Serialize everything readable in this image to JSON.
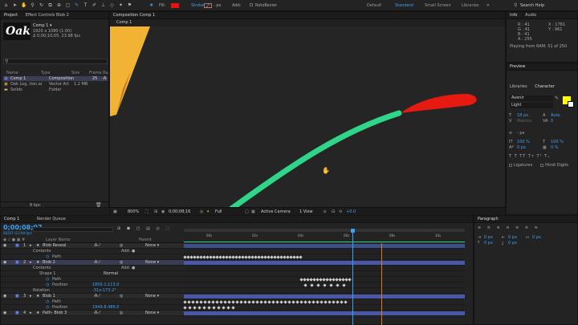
{
  "toolbar": {
    "fill_label": "Fill:",
    "stroke_label": "Stroke:",
    "stroke_width": "- px",
    "add_label": "Add:",
    "rotobezier_label": "RotoBezier",
    "workspaces": [
      "Default",
      "Standard",
      "Small Screen",
      "Libraries"
    ],
    "search_placeholder": "Search Help"
  },
  "project": {
    "tab_project": "Project",
    "tab_effect_controls": "Effect Controls Blob 2",
    "comp_name": "Comp 1 ▾",
    "comp_info1": "1920 x 1080 (1.00)",
    "comp_info2": "Δ 0;00;10;05, 23.98 fps",
    "logo_text": "Oak",
    "columns": [
      "Name",
      "Type",
      "Size",
      "Frame Ra..."
    ],
    "items": [
      {
        "name": "Comp 1",
        "type": "Composition",
        "size": "",
        "rate": "25"
      },
      {
        "name": "Oak Log..tion.ai",
        "type": "Vector Art",
        "size": "1.2 MB",
        "rate": ""
      },
      {
        "name": "Solids",
        "type": "Folder",
        "size": "",
        "rate": ""
      }
    ],
    "bpc": "8 bpc"
  },
  "composition": {
    "tab": "Composition Comp 1",
    "comp_tab": "Comp 1",
    "zoom": "800%",
    "timecode": "0;00;08;16",
    "resolution": "Full",
    "camera": "Active Camera",
    "views": "1 View",
    "exposure": "+0.0"
  },
  "info": {
    "tab_info": "Info",
    "tab_audio": "Audio",
    "r": "R : 41",
    "g": "G : 41",
    "b": "B : 41",
    "a": "A : 255",
    "x": "X : 1781",
    "y": "Y : 961",
    "playing": "Playing from RAM: 51 of 250",
    "preview": "Preview",
    "libraries": "Libraries",
    "character": "Character"
  },
  "character": {
    "font": "Avenir",
    "style": "Light",
    "size": "18 px",
    "leading": "Auto",
    "kerning": "Metrics",
    "tracking": "0",
    "stroke": "- px",
    "vscale": "100 %",
    "hscale": "100 %",
    "baseline": "0 px",
    "tsume": "0 %",
    "ligatures": "Ligatures",
    "hindi": "Hindi Digits",
    "fill_color": "#ffff00",
    "stroke_color": "#ffffff"
  },
  "paragraph": {
    "tab": "Paragraph",
    "v1": "0 px",
    "v2": "0 px",
    "v3": "0 px",
    "v4": "0 px",
    "v5": "0 px"
  },
  "timeline": {
    "tab_comp": "Comp 1",
    "tab_render": "Render Queue",
    "timecode": "0;00;08;07",
    "fps_line": "00207 (23.98 fps)",
    "col_layer": "Layer Name",
    "col_parent": "Parent",
    "ruler": [
      "00s",
      "02s",
      "04s",
      "06s",
      "08s",
      "10s",
      "12s"
    ],
    "rows": [
      {
        "kind": "layer",
        "num": "1",
        "name": "Blob Reveal",
        "parent": "None",
        "sel": false
      },
      {
        "kind": "prop",
        "name": "Contents",
        "add": "Add: ●"
      },
      {
        "kind": "sub",
        "name": "Path"
      },
      {
        "kind": "layer",
        "num": "2",
        "name": "Blob 2",
        "parent": "None",
        "sel": true
      },
      {
        "kind": "prop",
        "name": "Contents",
        "add": "Add: ●"
      },
      {
        "kind": "prop2",
        "name": "Shape 1",
        "value": "Normal"
      },
      {
        "kind": "sub",
        "name": "Path"
      },
      {
        "kind": "sub",
        "name": "Position",
        "value": "1809.1,113.0"
      },
      {
        "kind": "prop",
        "name": "Rotation",
        "value": "-31x-173.2°"
      },
      {
        "kind": "layer",
        "num": "3",
        "name": "Blob 1",
        "parent": "None",
        "sel": false
      },
      {
        "kind": "sub",
        "name": "Path"
      },
      {
        "kind": "sub",
        "name": "Position",
        "value": "1949.8,486.0"
      },
      {
        "kind": "layer",
        "num": "4",
        "name": "Path- Blob 3",
        "parent": "None",
        "sel": false
      }
    ]
  },
  "colors": {
    "accent": "#3ca0f0",
    "fill": "#e81212",
    "layer_bar": "#4a56a8",
    "trail": "#2fd68a",
    "blob": "#e61a10",
    "orange_shape": "#f2b233"
  }
}
